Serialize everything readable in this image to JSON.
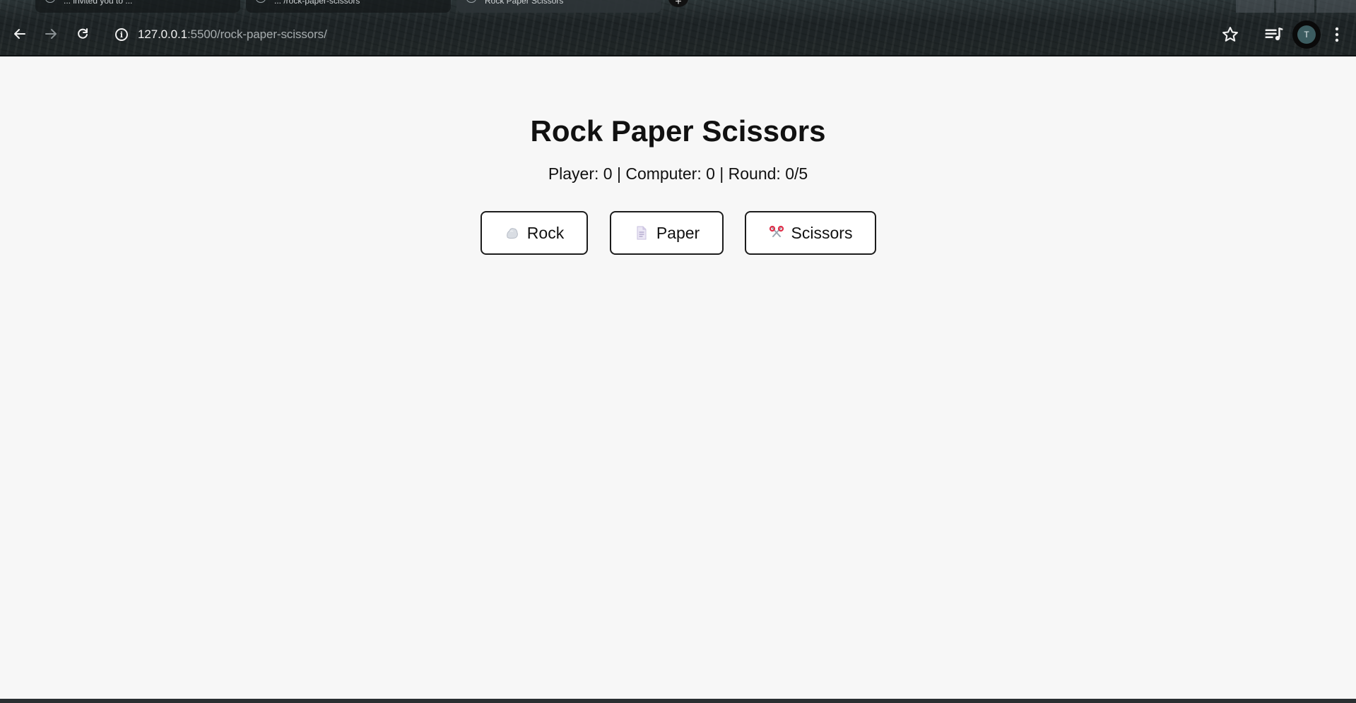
{
  "browser": {
    "tabs": [
      {
        "title": "... invited you to ... ",
        "active": false
      },
      {
        "title": "... /rock-paper-scissors",
        "active": false
      },
      {
        "title": "Rock Paper Scissors",
        "active": true
      }
    ],
    "url_host": "127.0.0.1",
    "url_rest": ":5500/rock-paper-scissors/",
    "avatar_letter": "T",
    "icons": [
      "back-arrow-icon",
      "forward-arrow-icon",
      "reload-icon",
      "info-icon",
      "star-icon",
      "media-controls-icon",
      "kebab-menu-icon"
    ]
  },
  "game": {
    "title": "Rock Paper Scissors",
    "score_text": "Player: 0 | Computer: 0 | Round: 0/5",
    "player_score": 0,
    "computer_score": 0,
    "round": 0,
    "total_rounds": 5,
    "choices": [
      {
        "label": "Rock",
        "icon": "rock-icon"
      },
      {
        "label": "Paper",
        "icon": "paper-icon"
      },
      {
        "label": "Scissors",
        "icon": "scissors-icon"
      }
    ]
  },
  "colors": {
    "page_background": "#f7f7f7",
    "button_border": "#1c1c1c",
    "text": "#111111"
  }
}
